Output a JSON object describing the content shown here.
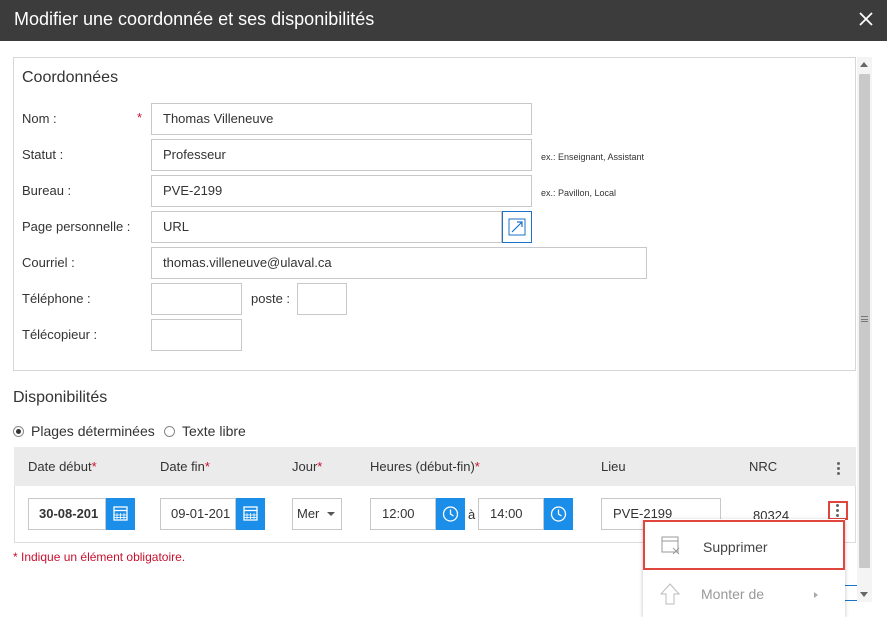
{
  "dialog": {
    "title": "Modifier une coordonnée et ses disponibilités"
  },
  "coordonnees": {
    "section_title": "Coordonnées",
    "nom": {
      "label": "Nom :",
      "required_mark": "*",
      "value": "Thomas Villeneuve"
    },
    "statut": {
      "label": "Statut :",
      "value": "Professeur",
      "hint": "ex.: Enseignant, Assistant"
    },
    "bureau": {
      "label": "Bureau :",
      "value": "PVE-2199",
      "hint": "ex.: Pavillon, Local"
    },
    "page_perso": {
      "label": "Page personnelle :",
      "value": "URL"
    },
    "courriel": {
      "label": "Courriel :",
      "value": "thomas.villeneuve@ulaval.ca"
    },
    "telephone": {
      "label": "Téléphone :",
      "value": ""
    },
    "poste": {
      "label": "poste :",
      "value": ""
    },
    "telecopieur": {
      "label": "Télécopieur :",
      "value": ""
    }
  },
  "disponibilites": {
    "section_title": "Disponibilités",
    "mode_options": [
      {
        "label": "Plages déterminées",
        "selected": true
      },
      {
        "label": "Texte libre",
        "selected": false
      }
    ],
    "columns": {
      "date_debut": "Date début",
      "date_fin": "Date fin",
      "jour": "Jour",
      "heures": "Heures (début-fin)",
      "lieu": "Lieu",
      "nrc": "NRC"
    },
    "required_mark": "*",
    "row": {
      "date_debut": "30-08-201",
      "date_fin": "09-01-201",
      "jour": "Mer",
      "heure_debut": "12:00",
      "separator": "à",
      "heure_fin": "14:00",
      "lieu": "PVE-2199",
      "nrc": "80324"
    }
  },
  "footnote": "* Indique un élément obligatoire.",
  "context_menu": {
    "items": [
      {
        "label": "Supprimer",
        "icon": "delete-window-icon",
        "enabled": true
      },
      {
        "label": "Monter de",
        "icon": "arrow-up-icon",
        "enabled": false
      }
    ]
  },
  "colors": {
    "accent": "#1a8ee8",
    "titlebar": "#3c3c3c",
    "required": "#c8102e",
    "focus": "#e0463c"
  }
}
